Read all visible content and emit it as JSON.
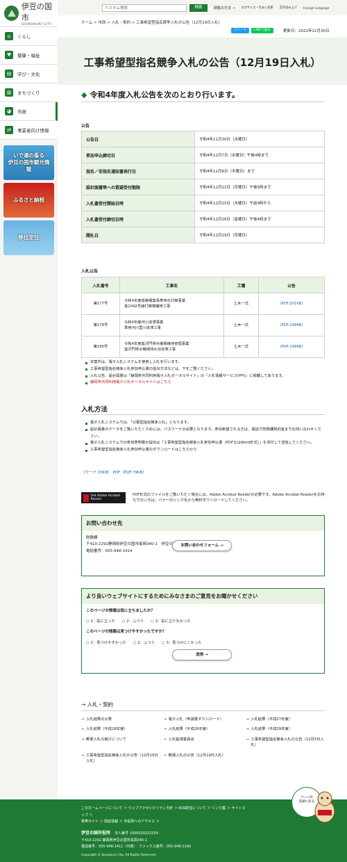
{
  "site": {
    "name_ja": "伊豆の国市",
    "name_en": "IZUNOKUNI CITY"
  },
  "nav": [
    {
      "label": "くらし",
      "icon": "house-icon"
    },
    {
      "label": "健康・福祉",
      "icon": "heart-icon"
    },
    {
      "label": "学び・文化",
      "icon": "book-icon"
    },
    {
      "label": "まちづくり",
      "icon": "building-icon"
    },
    {
      "label": "市政",
      "icon": "pie-icon"
    },
    {
      "label": "事業者向け情報",
      "icon": "handshake-icon"
    }
  ],
  "banners": [
    "いで湯の香る\n伊豆の国市観光情報",
    "ふるさと納税",
    "移住定住"
  ],
  "top": {
    "search_placeholder": "カスタム検索",
    "search_btn": "検索",
    "browse": "閲覧の方法 →",
    "size": "文字サイズ・色あい変更",
    "voice": "音声読み上げ",
    "lang": "Foreign Language"
  },
  "breadcrumb": "ホーム > 市政 > 入札・契約 > 工事希望型指名競争入札の公告（12月19日入札）",
  "share": {
    "tweet": "ツイート",
    "line": "LINEで送る"
  },
  "updated": "更新日：2022年11月30日",
  "title": "工事希望型指名競争入札の公告（12月19日入札）",
  "lead": "令和4年度入札公告を次のとおり行います。",
  "notice_label": "公告",
  "notice": [
    [
      "公告日",
      "令和4年11月30日（水曜日）"
    ],
    [
      "参加申込締切日",
      "令和4年12月7日（水曜日）午後4時まで"
    ],
    [
      "指名／非指名通知書発行日",
      "令和4年12月8日（木曜日）まで"
    ],
    [
      "設計図書等への質疑受付期限",
      "令和4年12月12日（月曜日）午後5時まで"
    ],
    [
      "入札書受付開始日時",
      "令和4年12月15日（木曜日）午前9時から"
    ],
    [
      "入札書受付締切日時",
      "令和4年12月16日（金曜日）午後4時まで"
    ],
    [
      "開札日",
      "令和4年12月19日（月曜日）"
    ]
  ],
  "bid_label": "入札公告",
  "bid_headers": [
    "入札番号",
    "工事名",
    "工種",
    "公告"
  ],
  "bids": [
    {
      "no": "第177号",
      "name1": "令和4年度道路構築長寿命化対策事業",
      "name2": "長1042号線打擲橋補修工事",
      "type": "土木一式",
      "pdf": "（PDF:201KB）"
    },
    {
      "no": "第178号",
      "name1": "令和4年度河川浚渫事業",
      "name2": "準用河川里川浚渫工事",
      "type": "土木一式",
      "pdf": "（PDF:199KB）"
    },
    {
      "no": "第180号",
      "name1": "令和4年度韮沢門排水機場維持管理事業",
      "name2": "韮沢門排水機場排水池浚渫工事",
      "type": "土木一式",
      "pdf": "（PDF:199KB）"
    }
  ],
  "notes": [
    "本案件は、電子入札システムを使用し入札を行います。",
    "工事希望型指名競争入札参加申込書の提出方法などは、下をご覧ください。",
    "入札公告、設計図書は「静岡県共同利用電子入札ポータルサイト」の「入札情報サービス(PPI)」に掲載してあります。",
    "静岡県共同利用電子入札ポータルサイトはこちら"
  ],
  "method_title": "入札方法",
  "method": [
    "電子入札システムでは、「公募型指名競争入札」となります。",
    "設計図書のデータをご覧いただくためには、パスワードが必要となります。参加希望される方は、電話で財務課契約室までお問い合わせください。",
    "電子入札システムでの参加表明書の提出は「工事希望型指名競争入札参加申込書（PDF又はWord形式）」を添付して送信してください。",
    "工事希望型指名競争入札参加申込書のダウンロードはこちらから"
  ],
  "dl_links": "（ワード:33KB）  PDF（PDF:79KB）",
  "adobe": {
    "btn": "Get Adobe Acrobat Reader",
    "text": "PDF形式のファイルをご覧いただく場合には、Adobe Acrobat Readerが必要です。Adobe Acrobat Readerをお持ちでない方は、バナーのリンク先から無料ダウンロードしてください。"
  },
  "contact": {
    "title": "お問い合わせ先",
    "dept": "財務課",
    "addr": "〒410-2292静岡県伊豆の国市長岡340-1　伊豆の国市役所伊豆長岡庁舎2階",
    "tel": "電話番号：055-948-1414",
    "btn": "お問い合わせフォーム →"
  },
  "survey": {
    "title": "より良いウェブサイトにするためにみなさまのご意見をお聞かせください",
    "q1": "このページの情報は役に立ちましたか？",
    "o1": [
      "1：役に立った",
      "2：ふつう",
      "3：役に立たなかった"
    ],
    "q2": "このページの情報は見つけやすかったですか？",
    "o2": [
      "1：見つけやすかった",
      "2：ふつう",
      "3：見つけにくかった"
    ],
    "btn": "送信 →"
  },
  "related_title": "→ 入札・契約",
  "related": [
    "入札結果の公表",
    "電子入札（申請書ダウンロード）",
    "入札結果（平成27年度）",
    "入札結果（平成28年度）",
    "入札結果（平成26年度）",
    "入札結果（平成29年度）",
    "郵便入札の執行について",
    "入札監視委員会",
    "工事希望型指名競争入札の公告（12月5日入札）",
    "工事希望型指名競争入札の公告（12月19日入札）",
    "郵便入札の公告（12月19日入札）"
  ],
  "totop": "ページの\n先頭へ戻る",
  "footer": {
    "links": "このホームページについて ＞ ウェブアクセシビリティ方針 ＞ RSS配信について ＞ リンク集 ＞ サイトマップ ＞\n携帯サイト ＞ 間窓情報 ＞ 市役所へのアクセス ＞",
    "org": "伊豆の国市役所",
    "corp": "法人番号 1000020222259",
    "addr": "〒410-2292 静岡県伊豆の国市長岡340-1",
    "tel": "電話番号：055-948-1411（代表）　ファックス番号：055-948-1169",
    "copy": "Copyright © Izunokuni City. All Rights Reserved."
  }
}
